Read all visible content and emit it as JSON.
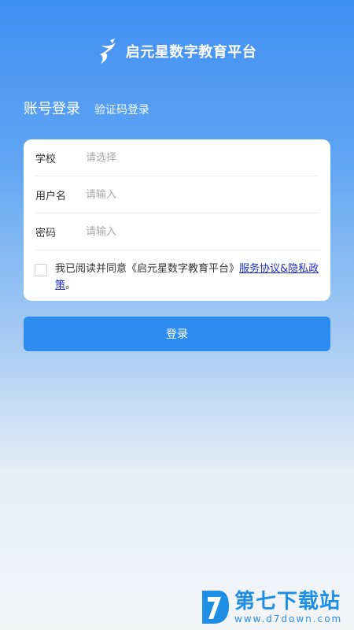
{
  "brand": {
    "logo_icon": "runner-star-logo",
    "title": "启元星数字教育平台"
  },
  "tabs": {
    "account_login": "账号登录",
    "code_login": "验证码登录"
  },
  "form": {
    "school": {
      "label": "学校",
      "placeholder": "请选择"
    },
    "username": {
      "label": "用户名",
      "placeholder": "请输入"
    },
    "password": {
      "label": "密码",
      "placeholder": "请输入"
    }
  },
  "agreement": {
    "checked": false,
    "text": "我已阅读并同意《启元星数字教育平台》",
    "link_service": "服务协议",
    "amp": "&",
    "link_privacy": "隐私政策",
    "period": "。"
  },
  "login_button": "登录",
  "watermark": {
    "title": "第七下载站",
    "url": "www.d7down.com"
  },
  "colors": {
    "primary": "#2d8cf0",
    "link": "#1a2cc8",
    "watermark": "#1f8fe6"
  }
}
